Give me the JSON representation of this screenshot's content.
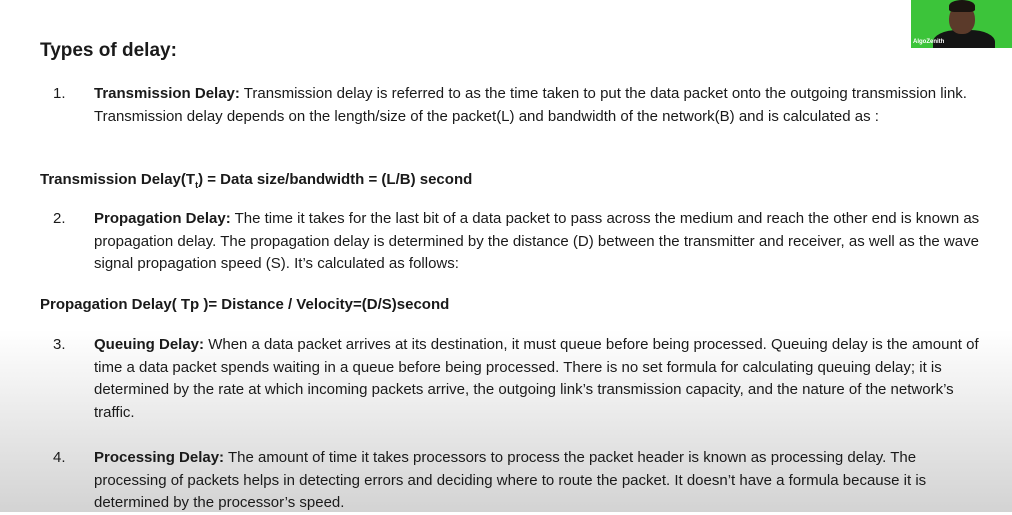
{
  "page": {
    "title": "Types of delay:"
  },
  "items": [
    {
      "number": "1.",
      "term": "Transmission Delay:",
      "text": " Transmission delay is referred to as the time taken to put the data packet onto the outgoing transmission link. Transmission delay depends on the length/size of the packet(L) and bandwidth of the network(B) and is calculated as :"
    },
    {
      "number": "2.",
      "term": "Propagation Delay:",
      "text": " The time it takes for the last bit of a data packet to pass across the medium and reach the other end is known as propagation delay. The propagation delay is determined by the distance (D) between the transmitter and receiver, as well as the wave signal propagation speed (S). It’s calculated as follows:"
    },
    {
      "number": "3.",
      "term": "Queuing Delay:",
      "text": " When a data packet arrives at its destination, it must queue before being processed. Queuing delay is the amount of time a data packet spends waiting in a queue before being processed. There is no set formula for calculating queuing delay; it is determined by the rate at which incoming packets arrive, the outgoing link’s transmission capacity, and the nature of the network’s traffic."
    },
    {
      "number": "4.",
      "term": "Processing Delay:",
      "text": " The amount of time it takes processors to process the packet header is known as processing delay. The processing of packets helps in detecting errors and deciding where to route the packet. It doesn’t have a formula because it is determined by the processor’s speed."
    }
  ],
  "formulas": {
    "transmission_pre": "Transmission Delay(T",
    "transmission_sub": "t",
    "transmission_post": ") = Data size/bandwidth = (L/B) second",
    "propagation": "Propagation Delay( Tp )= Distance / Velocity=(D/S)second"
  },
  "webcam": {
    "label": "AlgoZenith"
  }
}
